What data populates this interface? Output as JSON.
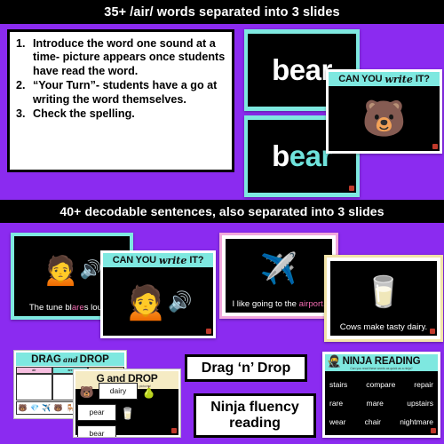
{
  "background_color": "#8B2BF0",
  "accent_teal": "#7EE8E0",
  "banners": {
    "top": "35+ /air/ words separated into 3 slides",
    "middle": "40+ decodable sentences, also separated into 3 slides"
  },
  "steps_card": {
    "items": [
      {
        "num": "1.",
        "text": "Introduce the word one sound at a time- picture appears once students have read the word."
      },
      {
        "num": "2.",
        "text": "“Your Turn”- students have a go at writing the word themselves."
      },
      {
        "num": "3.",
        "text": "Check the spelling."
      }
    ]
  },
  "word_cards": [
    {
      "word_plain": "bear",
      "word_part1": "b",
      "word_part2": "ear",
      "highlight": false,
      "icon": "bear-icon"
    },
    {
      "word_plain": "bear",
      "word_part1": "b",
      "word_part2": "ear",
      "highlight": true,
      "icon": "bear-icon"
    }
  ],
  "write_cards": [
    {
      "head_bold_1": "CAN YOU",
      "head_script": "write",
      "head_bold_2": "IT?",
      "art_icon": "bear-icon",
      "art_glyph": "🐻"
    },
    {
      "head_bold_1": "CAN YOU",
      "head_script": "write",
      "head_bold_2": "IT?",
      "art_icon": "girl-covering-ears-icon",
      "art_glyph": "🙍"
    }
  ],
  "sentence_cards": [
    {
      "name": "tune",
      "border_color": "#7EE8E0",
      "pre": "The tune bl",
      "hl": "are",
      "post": "s loudly.",
      "art_glyph": "🙍",
      "speaker_glyph": "🔊"
    },
    {
      "name": "airport",
      "border_color": "#F2A8DC",
      "pre": "I like going to the ",
      "hl": "airport",
      "post": ".",
      "art_glyph": "✈️"
    },
    {
      "name": "dairy",
      "border_color": "#F2E3A8",
      "pre": "Cows make tasty dairy.",
      "hl": "",
      "post": "",
      "art_glyph": "🥛"
    }
  ],
  "drag_drop_1": {
    "title_bold_1": "DRAG",
    "title_script": "and",
    "title_bold_2": "DROP",
    "columns": [
      "air",
      "are",
      "ear"
    ],
    "picture_glyphs": [
      "🐻",
      "💎",
      "✈️",
      "🐻",
      "🪑",
      "🥛",
      "🐎",
      "👕",
      "🍐"
    ]
  },
  "drag_drop_2": {
    "title": "G and DROP",
    "subtitle": "Match the words with the pictures!",
    "tiles": [
      {
        "type": "picture",
        "glyph": "🐻"
      },
      {
        "type": "word",
        "label": "dairy"
      },
      {
        "type": "picture",
        "glyph": "🍐"
      },
      {
        "type": "word",
        "label": "pear"
      },
      {
        "type": "picture",
        "glyph": "🥛"
      },
      {
        "type": "word",
        "label": "bear"
      }
    ]
  },
  "labels": {
    "drag_n_drop": "Drag ‘n’ Drop",
    "ninja_fluency": "Ninja fluency reading"
  },
  "ninja_card": {
    "title": "NINJA READING",
    "subtitle": "Can you read these words as quick as a ninja?",
    "icon": "ninja-icon",
    "rows": [
      [
        "stairs",
        "compare",
        "repair"
      ],
      [
        "rare",
        "mare",
        "upstairs"
      ],
      [
        "wear",
        "chair",
        "nightmare"
      ]
    ]
  }
}
